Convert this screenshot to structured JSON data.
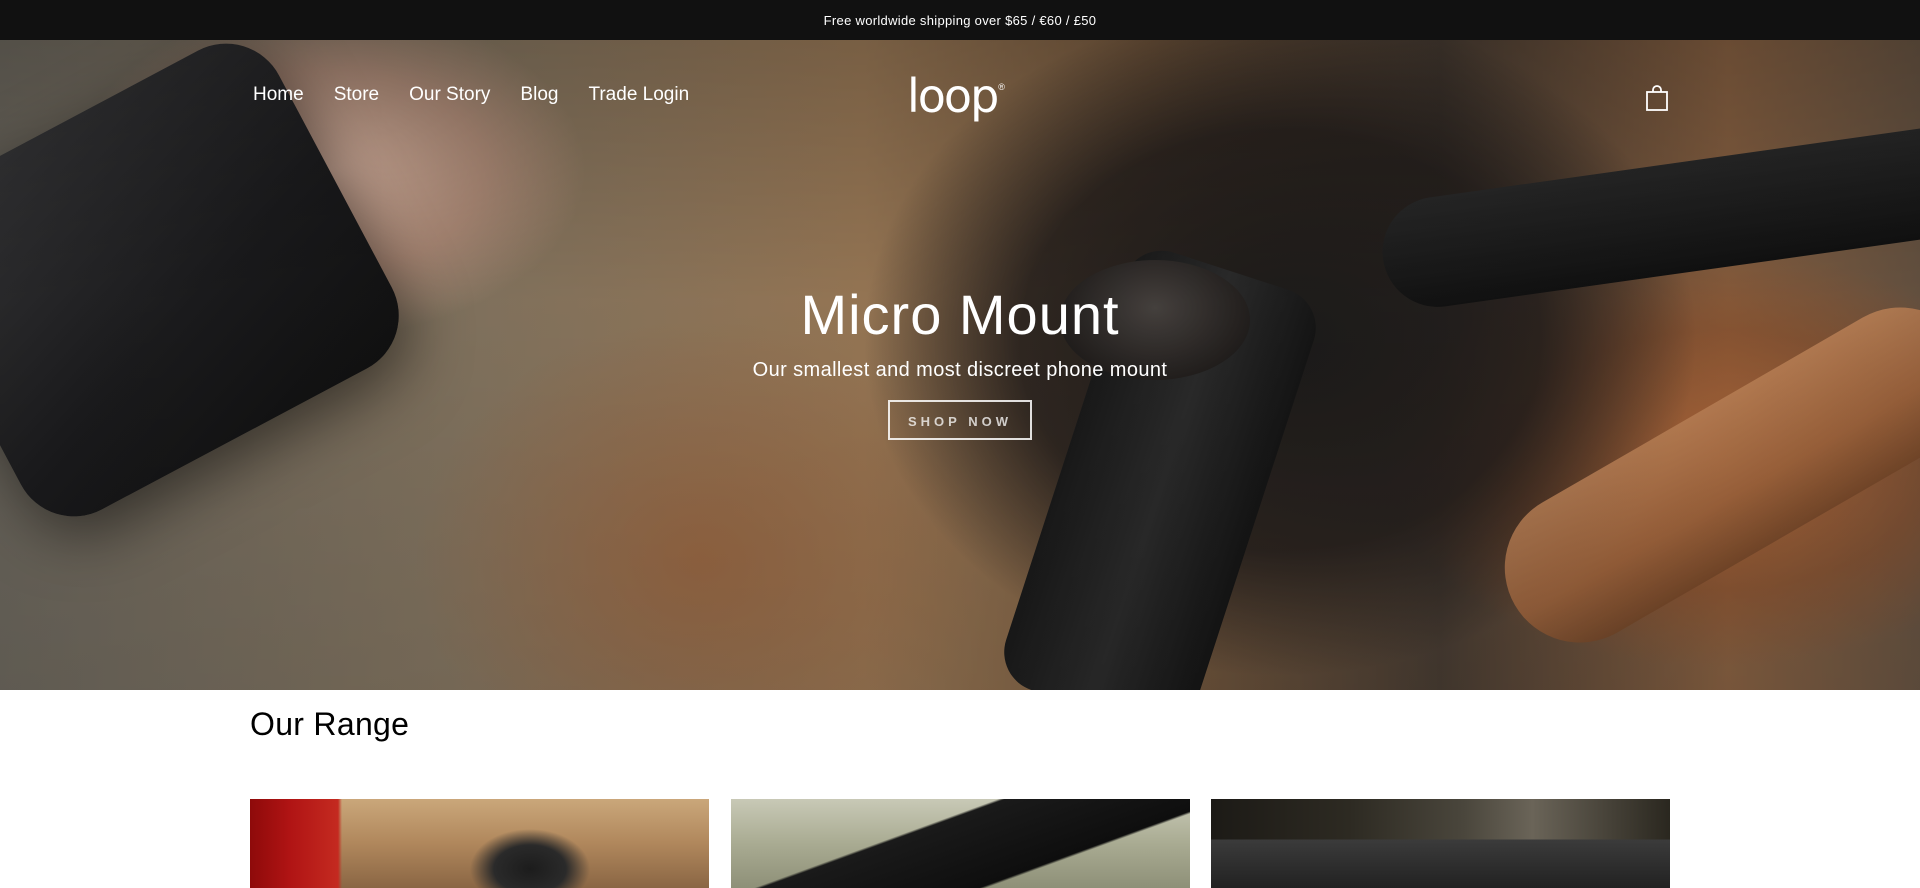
{
  "announcement": {
    "text": "Free worldwide shipping over $65 / €60 / £50"
  },
  "nav": {
    "items": [
      {
        "label": "Home"
      },
      {
        "label": "Store"
      },
      {
        "label": "Our Story"
      },
      {
        "label": "Blog"
      },
      {
        "label": "Trade Login"
      }
    ]
  },
  "brand": {
    "logo_text": "loop",
    "logo_mark": "®"
  },
  "header": {
    "cart_icon": "shopping-bag-icon"
  },
  "hero": {
    "title": "Micro Mount",
    "subtitle": "Our smallest and most discreet phone mount",
    "cta_label": "SHOP NOW"
  },
  "range": {
    "title": "Our Range"
  },
  "colors": {
    "announcement_bg": "#111111",
    "text_light": "#ffffff",
    "text_dark": "#000000"
  }
}
